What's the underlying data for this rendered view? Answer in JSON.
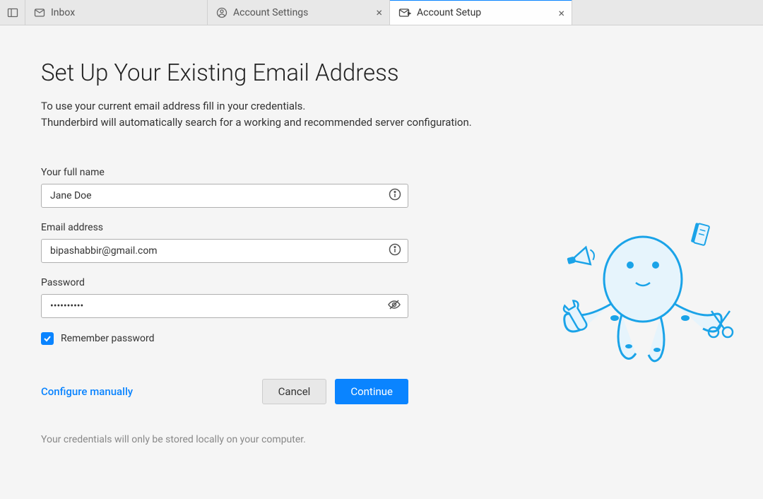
{
  "tabs": {
    "inbox": "Inbox",
    "settings": "Account Settings",
    "setup": "Account Setup"
  },
  "page": {
    "title": "Set Up Your Existing Email Address",
    "description_line1": "To use your current email address fill in your credentials.",
    "description_line2": "Thunderbird will automatically search for a working and recommended server configuration."
  },
  "form": {
    "name_label": "Your full name",
    "name_value": "Jane Doe",
    "email_label": "Email address",
    "email_value": "bipashabbir@gmail.com",
    "password_label": "Password",
    "password_value": "••••••••••",
    "remember_label": "Remember password"
  },
  "actions": {
    "configure_manually": "Configure manually",
    "cancel": "Cancel",
    "continue": "Continue"
  },
  "footer": {
    "note": "Your credentials will only be stored locally on your computer."
  }
}
